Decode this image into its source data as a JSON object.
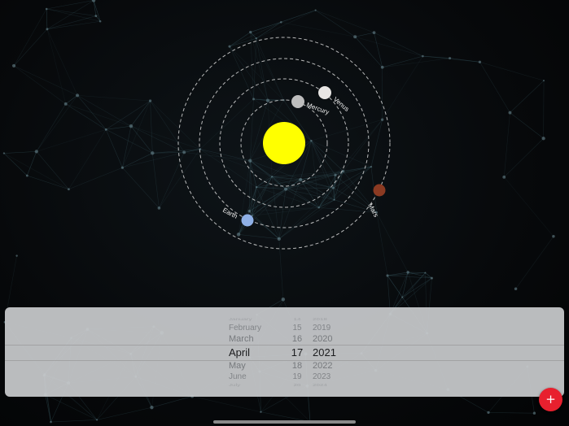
{
  "colors": {
    "sun": "#ffff00",
    "mercury": "#bdbdbd",
    "venus": "#e8e6e4",
    "earth": "#8fb0e6",
    "mars": "#8b3a22",
    "add_button": "#e8202e",
    "orbit": "#d8d8d8"
  },
  "planets": {
    "mercury": {
      "label": "Mercury"
    },
    "venus": {
      "label": "Venus"
    },
    "earth": {
      "label": "Earth"
    },
    "mars": {
      "label": "Mars"
    }
  },
  "date_picker": {
    "months": [
      "January",
      "February",
      "March",
      "April",
      "May",
      "June",
      "July"
    ],
    "days": [
      "14",
      "15",
      "16",
      "17",
      "18",
      "19",
      "20"
    ],
    "years": [
      "2018",
      "2019",
      "2020",
      "2021",
      "2022",
      "2023",
      "2024"
    ],
    "selected": {
      "month": "April",
      "day": "17",
      "year": "2021"
    }
  },
  "add_button": {
    "label": "+",
    "icon": "plus-icon"
  }
}
